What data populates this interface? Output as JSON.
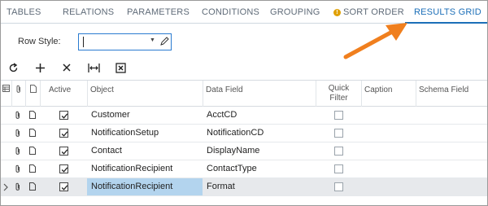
{
  "tabs": [
    {
      "label": "TABLES"
    },
    {
      "label": "RELATIONS"
    },
    {
      "label": "PARAMETERS"
    },
    {
      "label": "CONDITIONS"
    },
    {
      "label": "GROUPING"
    },
    {
      "label": "SORT ORDER",
      "warning": true
    },
    {
      "label": "RESULTS GRID",
      "active": true
    }
  ],
  "form": {
    "row_style_label": "Row Style:",
    "row_style_value": ""
  },
  "toolbar": {
    "icons": [
      "refresh-icon",
      "add-icon",
      "delete-icon",
      "fit-columns-icon",
      "export-excel-icon"
    ]
  },
  "grid": {
    "columns": {
      "active": "Active",
      "object": "Object",
      "data_field": "Data Field",
      "quick_filter": "Quick Filter",
      "caption": "Caption",
      "schema_field": "Schema Field"
    },
    "rows": [
      {
        "active": true,
        "object": "Customer",
        "data_field": "AcctCD",
        "quick_filter": false,
        "caption": "",
        "schema_field": ""
      },
      {
        "active": true,
        "object": "NotificationSetup",
        "data_field": "NotificationCD",
        "quick_filter": false,
        "caption": "",
        "schema_field": ""
      },
      {
        "active": true,
        "object": "Contact",
        "data_field": "DisplayName",
        "quick_filter": false,
        "caption": "",
        "schema_field": ""
      },
      {
        "active": true,
        "object": "NotificationRecipient",
        "data_field": "ContactType",
        "quick_filter": false,
        "caption": "",
        "schema_field": ""
      },
      {
        "active": true,
        "object": "NotificationRecipient",
        "data_field": "Format",
        "quick_filter": false,
        "caption": "",
        "schema_field": "",
        "current": true
      }
    ]
  },
  "colors": {
    "accent": "#1c6fb8",
    "annotation_arrow": "#f07f1e",
    "selected_cell": "#b3d4ee",
    "warning": "#e0a000"
  }
}
